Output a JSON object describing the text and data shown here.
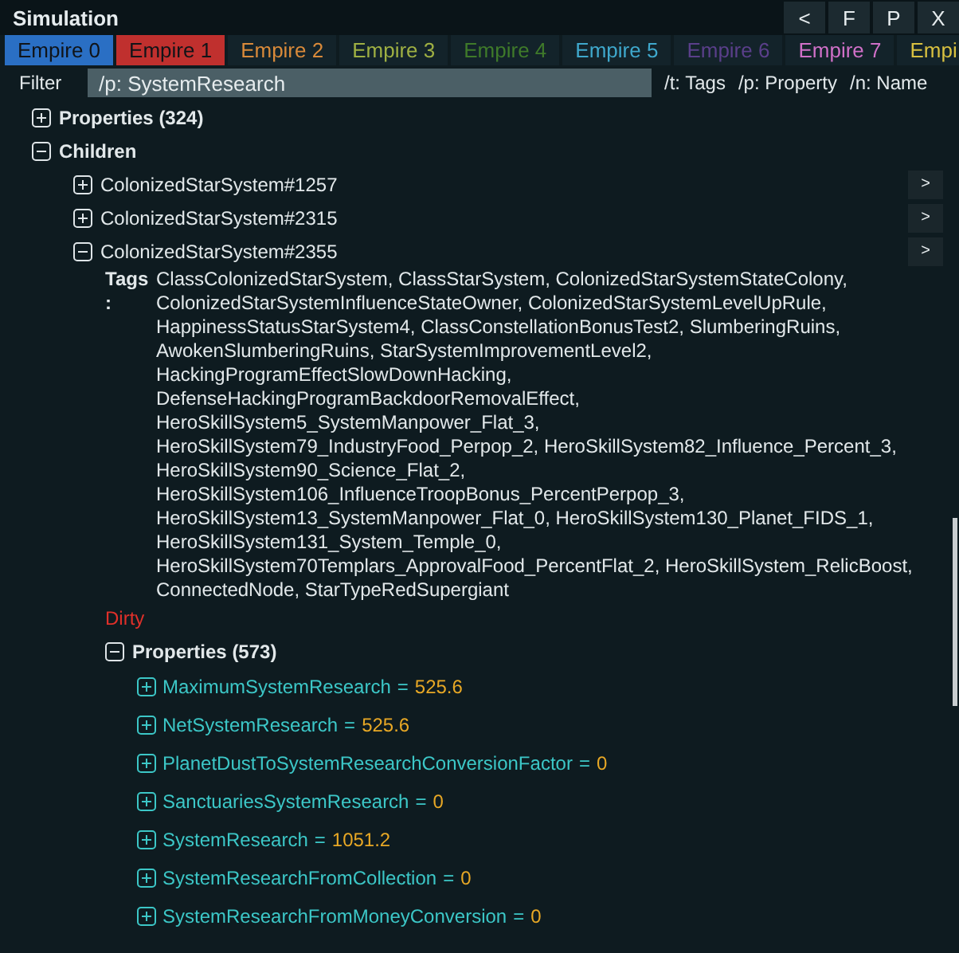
{
  "window": {
    "title": "Simulation",
    "buttons": [
      "<",
      "F",
      "P",
      "X"
    ]
  },
  "tabs": [
    {
      "label": "Empire 0",
      "highlighted": true,
      "color": "#2a6fc4"
    },
    {
      "label": "Empire 1",
      "highlighted": true,
      "color": "#c0302e"
    },
    {
      "label": "Empire 2",
      "highlighted": false,
      "color": "#d98a3a"
    },
    {
      "label": "Empire 3",
      "highlighted": false,
      "color": "#9fb043"
    },
    {
      "label": "Empire 4",
      "highlighted": false,
      "color": "#3f7a2a"
    },
    {
      "label": "Empire 5",
      "highlighted": false,
      "color": "#3fa8cc"
    },
    {
      "label": "Empire 6",
      "highlighted": false,
      "color": "#5a3f8a"
    },
    {
      "label": "Empire 7",
      "highlighted": false,
      "color": "#d070c8"
    },
    {
      "label": "Empi",
      "highlighted": false,
      "color": "#d8c040"
    }
  ],
  "filter": {
    "label": "Filter",
    "value": "/p: SystemResearch",
    "hints": [
      "/t: Tags",
      "/p: Property",
      "/n: Name"
    ]
  },
  "tree": {
    "top_properties": {
      "label": "Properties (324)",
      "expanded": false
    },
    "children": {
      "label": "Children",
      "expanded": true,
      "items": [
        {
          "name": "ColonizedStarSystem#1257",
          "expanded": false,
          "go": ">"
        },
        {
          "name": "ColonizedStarSystem#2315",
          "expanded": false,
          "go": ">"
        },
        {
          "name": "ColonizedStarSystem#2355",
          "expanded": true,
          "go": ">",
          "tags_label": "Tags :",
          "tags": "ClassColonizedStarSystem, ClassStarSystem, ColonizedStarSystemStateColony, ColonizedStarSystemInfluenceStateOwner, ColonizedStarSystemLevelUpRule, HappinessStatusStarSystem4, ClassConstellationBonusTest2, SlumberingRuins, AwokenSlumberingRuins, StarSystemImprovementLevel2, HackingProgramEffectSlowDownHacking, DefenseHackingProgramBackdoorRemovalEffect, HeroSkillSystem5_SystemManpower_Flat_3, HeroSkillSystem79_IndustryFood_Perpop_2, HeroSkillSystem82_Influence_Percent_3, HeroSkillSystem90_Science_Flat_2, HeroSkillSystem106_InfluenceTroopBonus_PercentPerpop_3, HeroSkillSystem13_SystemManpower_Flat_0, HeroSkillSystem130_Planet_FIDS_1, HeroSkillSystem131_System_Temple_0, HeroSkillSystem70Templars_ApprovalFood_PercentFlat_2, HeroSkillSystem_RelicBoost, ConnectedNode, StarTypeRedSupergiant",
          "status": "Dirty",
          "properties": {
            "label": "Properties (573)",
            "expanded": true,
            "items": [
              {
                "name": "MaximumSystemResearch",
                "eq": "=",
                "value": "525.6",
                "expanded": false
              },
              {
                "name": "NetSystemResearch",
                "eq": "=",
                "value": "525.6",
                "expanded": false
              },
              {
                "name": "PlanetDustToSystemResearchConversionFactor",
                "eq": "=",
                "value": "0",
                "expanded": false
              },
              {
                "name": "SanctuariesSystemResearch",
                "eq": "=",
                "value": "0",
                "expanded": false
              },
              {
                "name": "SystemResearch",
                "eq": "=",
                "value": "1051.2",
                "expanded": false
              },
              {
                "name": "SystemResearchFromCollection",
                "eq": "=",
                "value": "0",
                "expanded": false
              },
              {
                "name": "SystemResearchFromMoneyConversion",
                "eq": "=",
                "value": "0",
                "expanded": false
              }
            ]
          }
        }
      ]
    }
  }
}
